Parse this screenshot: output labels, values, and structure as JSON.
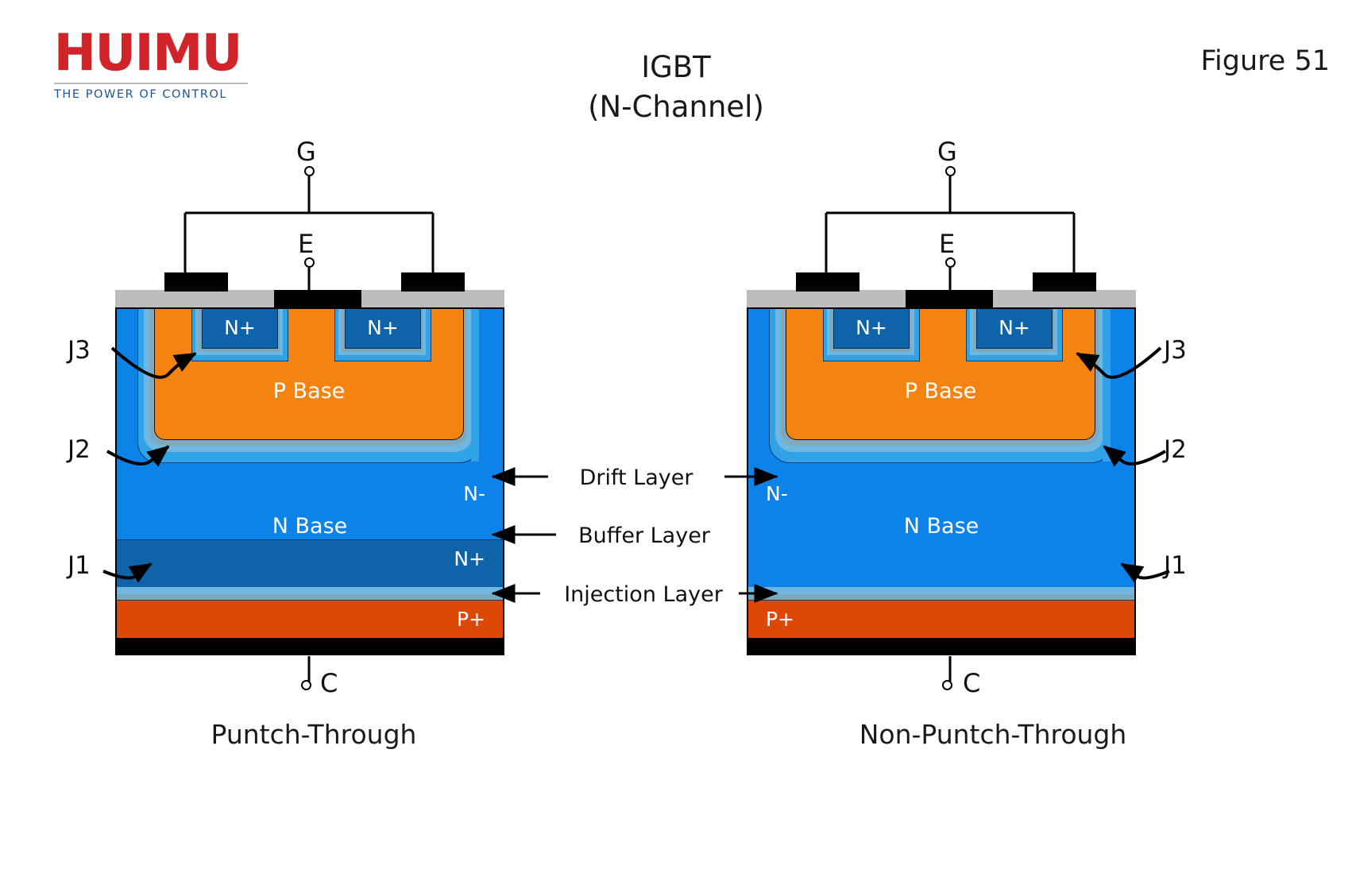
{
  "brand": {
    "name": "HUIMU",
    "tagline": "THE POWER OF CONTROL",
    "name_color": "#d1232a",
    "tagline_color": "#17559c"
  },
  "header": {
    "title_line1": "IGBT",
    "title_line2": "(N-Channel)",
    "figure_label": "Figure 51"
  },
  "palette": {
    "p_base": "#f5830f",
    "n_drift": "#0d82e8",
    "n_buffer": "#0f63a8",
    "n_plus": "#0f63a8",
    "p_plus": "#dd4807",
    "metal": "#000000",
    "oxide": "#bdbdbd",
    "junction_light": "#6fb7e0",
    "junction_mid": "#2fa2e8",
    "junction_gray": "#7fa8bd"
  },
  "annotations": {
    "drift_layer": "Drift Layer",
    "buffer_layer": "Buffer Layer",
    "injection_layer": "Injection Layer"
  },
  "devices": [
    {
      "id": "punch-through",
      "caption": "Puntch-Through",
      "terminals": {
        "gate": "G",
        "emitter": "E",
        "collector": "C"
      },
      "regions": {
        "n_plus_left": "N+",
        "n_plus_right": "N+",
        "p_base": "P Base",
        "n_base": "N Base",
        "n_drift": "N-",
        "n_buffer": "N+",
        "p_plus": "P+"
      },
      "junctions": [
        "J3",
        "J2",
        "J1"
      ],
      "has_buffer_layer": true
    },
    {
      "id": "non-punch-through",
      "caption": "Non-Puntch-Through",
      "terminals": {
        "gate": "G",
        "emitter": "E",
        "collector": "C"
      },
      "regions": {
        "n_plus_left": "N+",
        "n_plus_right": "N+",
        "p_base": "P Base",
        "n_base": "N Base",
        "n_drift": "N-",
        "p_plus": "P+"
      },
      "junctions": [
        "J3",
        "J2",
        "J1"
      ],
      "has_buffer_layer": false
    }
  ]
}
